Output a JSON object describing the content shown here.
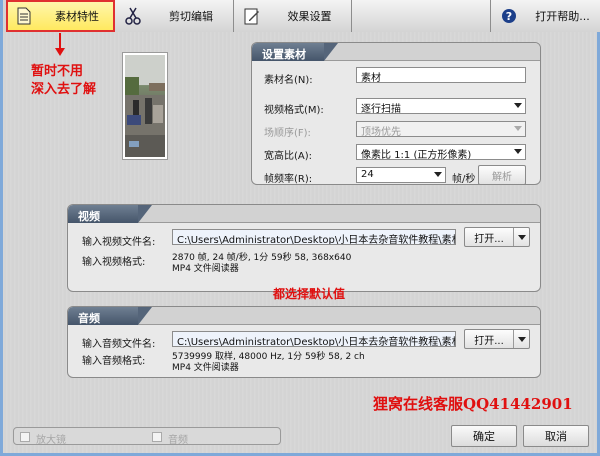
{
  "tabs": [
    {
      "label": "素材特性",
      "icon": "document-icon",
      "active": true
    },
    {
      "label": "剪切编辑",
      "icon": "scissors-icon",
      "active": false
    },
    {
      "label": "效果设置",
      "icon": "edit-icon",
      "active": false
    },
    {
      "label": "打开帮助...",
      "icon": "help-icon",
      "active": false
    }
  ],
  "annotations": {
    "note_line1": "暂时不用",
    "note_line2": "深入去了解",
    "center_note": "都选择默认值",
    "contact": "狸窝在线客服QQ41442901"
  },
  "settings": {
    "title": "设置素材",
    "name_label": "素材名(N):",
    "name_value": "素材",
    "video_format_label": "视频格式(M):",
    "video_format_value": "逐行扫描",
    "field_order_label": "场顺序(F):",
    "field_order_value": "顶场优先",
    "aspect_label": "宽高比(A):",
    "aspect_value": "像素比 1:1 (正方形像素)",
    "fps_label": "帧频率(R):",
    "fps_value": "24",
    "fps_unit": "帧/秒",
    "analyze_button": "解析"
  },
  "video": {
    "title": "视频",
    "file_label": "输入视频文件名:",
    "file_value": "C:\\Users\\Administrator\\Desktop\\小日本去杂音软件教程\\素材.mp4",
    "open_button": "打开...",
    "format_label": "输入视频格式:",
    "format_line1": "2870 帧, 24 帧/秒, 1分 59秒 58, 368x640",
    "format_line2": "MP4 文件阅读器"
  },
  "audio": {
    "title": "音频",
    "file_label": "输入音频文件名:",
    "file_value": "C:\\Users\\Administrator\\Desktop\\小日本去杂音软件教程\\素材.mp4",
    "open_button": "打开...",
    "format_label": "输入音频格式:",
    "format_line1": "5739999 取样, 48000 Hz, 1分 59秒 58, 2 ch",
    "format_line2": "MP4 文件阅读器"
  },
  "bottom": {
    "check1_label": "放大镜",
    "check2_label": "音频",
    "ok_button": "确定",
    "cancel_button": "取消"
  },
  "colors": {
    "annotation": "#e01010",
    "active_tab": "#ffe85a",
    "panel_title": "#55657a"
  }
}
